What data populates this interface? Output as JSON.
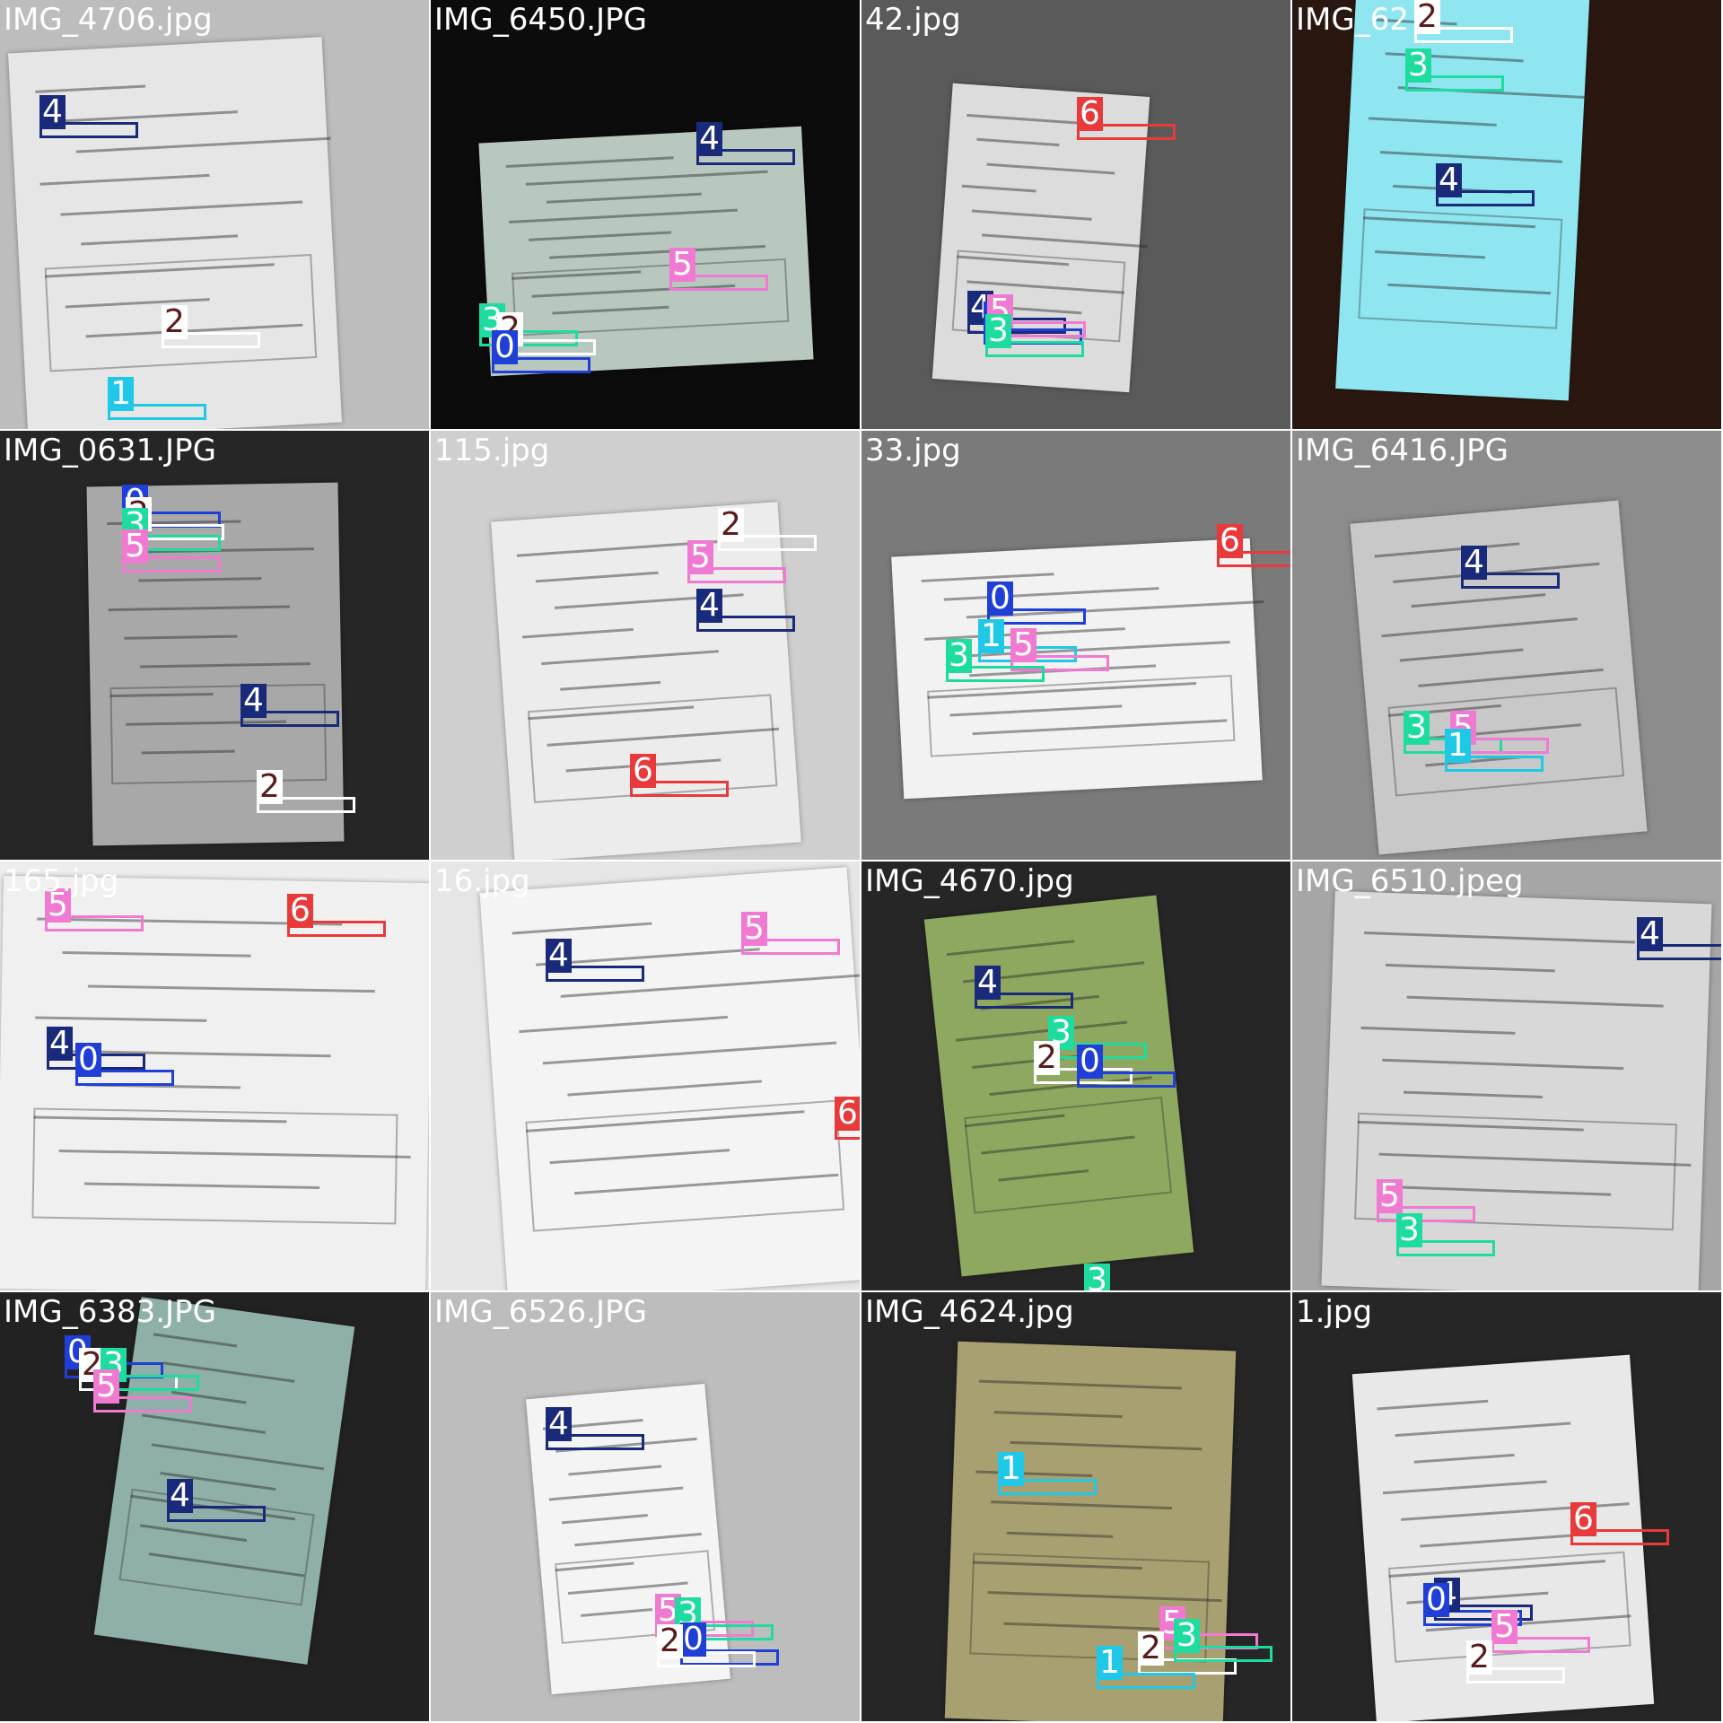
{
  "classes": {
    "0": {
      "label": "0",
      "box": "#1f3fd6",
      "fill": "#1f3fd6",
      "text": "#ffffff"
    },
    "1": {
      "label": "1",
      "box": "#1ec8e6",
      "fill": "#1ec8e6",
      "text": "#ffffff"
    },
    "2": {
      "label": "2",
      "box": "#ffffff",
      "fill": "#ffffff",
      "text": "#5a1a1a"
    },
    "3": {
      "label": "3",
      "box": "#1edca0",
      "fill": "#1edca0",
      "text": "#ffffff"
    },
    "4": {
      "label": "4",
      "box": "#1a2a7a",
      "fill": "#1a2a7a",
      "text": "#ffffff"
    },
    "5": {
      "label": "5",
      "box": "#f07ad2",
      "fill": "#f07ad2",
      "text": "#ffffff"
    },
    "6": {
      "label": "6",
      "box": "#e83a3a",
      "fill": "#e83a3a",
      "text": "#ffffff"
    }
  },
  "tiles": [
    {
      "filename": "IMG_4706.jpg",
      "bg": "#bdbdbd",
      "paper": "#e6e6e6",
      "label_color": "#ffffff",
      "tags": [
        "4",
        "1",
        "2"
      ]
    },
    {
      "filename": "IMG_6450.JPG",
      "bg": "#0c0c0c",
      "paper": "#b9c8bf",
      "label_color": "#ffffff",
      "tags": [
        "4",
        "3",
        "2",
        "5",
        "0"
      ]
    },
    {
      "filename": "42.jpg",
      "bg": "#5a5a5a",
      "paper": "#dcdcdc",
      "label_color": "#ffffff",
      "tags": [
        "6",
        "4",
        "0",
        "5",
        "3"
      ]
    },
    {
      "filename": "IMG_62",
      "bg": "#2a1810",
      "paper": "#8fe6f0",
      "label_color": "#ffffff",
      "tags": [
        "2",
        "3",
        "4"
      ]
    },
    {
      "filename": "IMG_0631.JPG",
      "bg": "#262626",
      "paper": "#a8a8a8",
      "label_color": "#ffffff",
      "tags": [
        "0",
        "2",
        "3",
        "5",
        "4",
        "2"
      ]
    },
    {
      "filename": "115.jpg",
      "bg": "#cfcfcf",
      "paper": "#ececec",
      "label_color": "#ffffff",
      "tags": [
        "2",
        "5",
        "4",
        "6"
      ]
    },
    {
      "filename": "33.jpg",
      "bg": "#7a7a7a",
      "paper": "#f2f2f2",
      "label_color": "#ffffff",
      "tags": [
        "6",
        "0",
        "1",
        "5",
        "3"
      ]
    },
    {
      "filename": "IMG_6416.JPG",
      "bg": "#8c8c8c",
      "paper": "#c8c8c8",
      "label_color": "#ffffff",
      "tags": [
        "4",
        "3",
        "5",
        "1"
      ]
    },
    {
      "filename": "165.jpg",
      "bg": "#ededed",
      "paper": "#f0f0f0",
      "label_color": "#ffffff",
      "tags": [
        "5",
        "6",
        "4",
        "0"
      ]
    },
    {
      "filename": "16.jpg",
      "bg": "#e6e6e6",
      "paper": "#f4f4f4",
      "label_color": "#ffffff",
      "tags": [
        "4",
        "5",
        "6"
      ]
    },
    {
      "filename": "IMG_4670.jpg",
      "bg": "#262626",
      "paper": "#8ea860",
      "label_color": "#ffffff",
      "tags": [
        "4",
        "3",
        "2",
        "0",
        "3"
      ]
    },
    {
      "filename": "IMG_6510.jpeg",
      "bg": "#a6a6a6",
      "paper": "#d8d8d8",
      "label_color": "#ffffff",
      "tags": [
        "4",
        "5",
        "3"
      ]
    },
    {
      "filename": "IMG_6383.JPG",
      "bg": "#222222",
      "paper": "#8fb0a8",
      "label_color": "#ffffff",
      "tags": [
        "0",
        "2",
        "3",
        "5",
        "4"
      ]
    },
    {
      "filename": "IMG_6526.JPG",
      "bg": "#bdbdbd",
      "paper": "#f4f4f4",
      "label_color": "#ffffff",
      "tags": [
        "4",
        "5",
        "3",
        "0",
        "2"
      ]
    },
    {
      "filename": "IMG_4624.jpg",
      "bg": "#262626",
      "paper": "#a8a070",
      "label_color": "#ffffff",
      "tags": [
        "1",
        "5",
        "2",
        "3",
        "1"
      ]
    },
    {
      "filename": "1.jpg",
      "bg": "#262626",
      "paper": "#e8e8e8",
      "label_color": "#ffffff",
      "tags": [
        "6",
        "4",
        "0",
        "5",
        "2"
      ]
    }
  ]
}
